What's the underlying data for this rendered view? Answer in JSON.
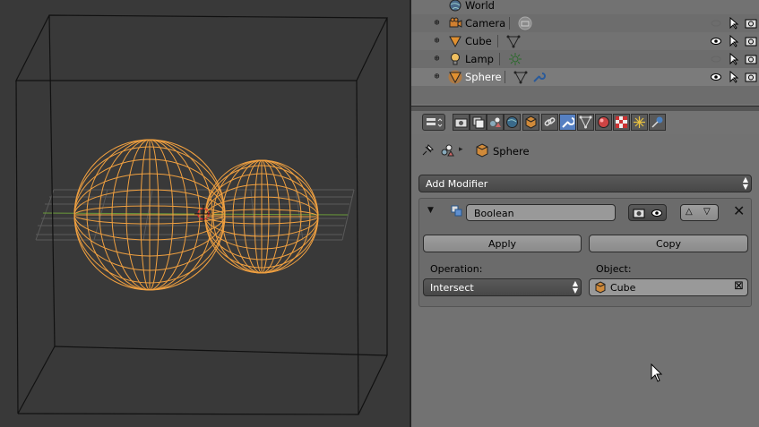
{
  "outliner": {
    "rows": [
      {
        "name": "World",
        "icon": "world-icon"
      },
      {
        "name": "Camera",
        "icon": "camera-icon"
      },
      {
        "name": "Cube",
        "icon": "mesh-icon"
      },
      {
        "name": "Lamp",
        "icon": "lamp-icon"
      },
      {
        "name": "Sphere",
        "icon": "mesh-icon"
      }
    ]
  },
  "properties": {
    "breadcrumb": {
      "object": "Sphere"
    },
    "add_modifier_label": "Add Modifier",
    "modifier": {
      "name": "Boolean",
      "apply_label": "Apply",
      "copy_label": "Copy",
      "operation_label": "Operation:",
      "operation_value": "Intersect",
      "object_label": "Object:",
      "object_value": "Cube"
    }
  },
  "colors": {
    "selection": "#f0a040",
    "active_tab": "#5680c2",
    "background": "#393939",
    "panel": "#727272"
  }
}
